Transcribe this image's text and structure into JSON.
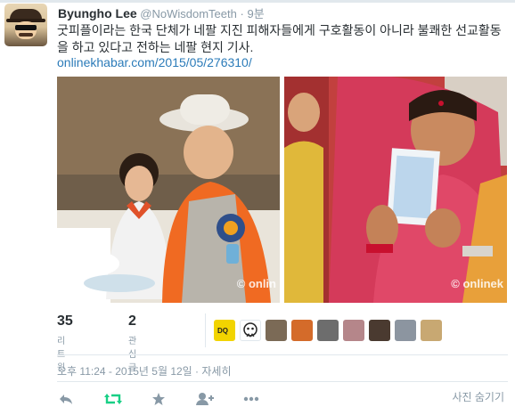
{
  "tweet": {
    "user_name": "Byungho Lee",
    "handle": "@NoWisdomTeeth",
    "separator": "·",
    "time_ago": "9분",
    "text": "굿피플이라는 한국 단체가 네팔 지진 피해자들에게 구호활동이 아니라 불쾌한 선교활동을 하고 있다고 전하는 네팔 현지 기사.",
    "link": "onlinekhabar.com/2015/05/276310/"
  },
  "photos": [
    {
      "watermark": "© onlin"
    },
    {
      "watermark": "© onlinek"
    }
  ],
  "stats": {
    "retweets_count": "35",
    "retweets_label": "리트윗",
    "favorites_count": "2",
    "favorites_label": "관심글"
  },
  "favoriter_avatars": [
    {
      "icon": "yellow-avatar-icon",
      "color": "#f2d400"
    },
    {
      "icon": "ghost-avatar-icon",
      "color": "#ffffff"
    },
    {
      "icon": "photo-avatar-icon",
      "color": "#7b6a56"
    },
    {
      "icon": "orange-avatar-icon",
      "color": "#d46b2a"
    },
    {
      "icon": "photo-avatar-icon",
      "color": "#6d6d6d"
    },
    {
      "icon": "photo-avatar-icon",
      "color": "#b5868a"
    },
    {
      "icon": "photo-avatar-icon",
      "color": "#4a3a30"
    },
    {
      "icon": "photo-avatar-icon",
      "color": "#8c95a0"
    },
    {
      "icon": "photo-avatar-icon",
      "color": "#c8a872"
    }
  ],
  "timestamp": "오후 11:24 - 2015년 5월 12일 · 자세히",
  "actions": {
    "hide_media": "사진 숨기기"
  },
  "colors": {
    "link": "#2b7bb9",
    "muted": "#8899a6",
    "retweet_active": "#19cf86",
    "border": "#e1e8ed"
  }
}
